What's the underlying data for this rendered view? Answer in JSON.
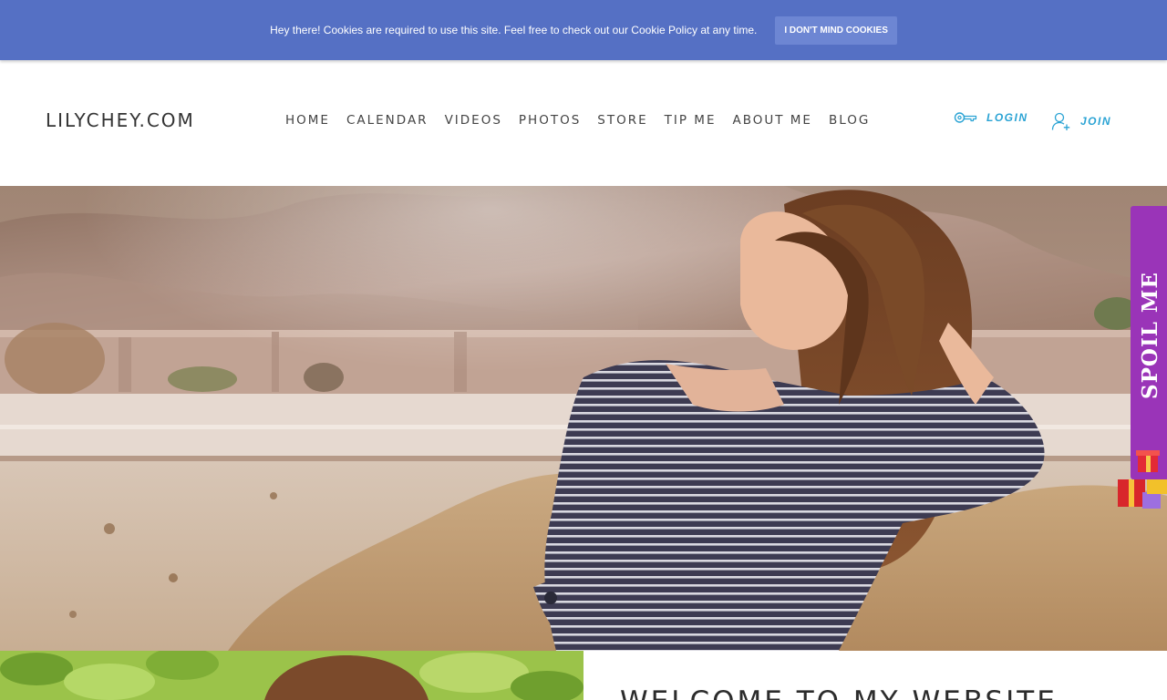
{
  "cookie_banner": {
    "message": "Hey there! Cookies are required to use this site. Feel free to check out our Cookie Policy at any time.",
    "button_label": "I DON'T MIND COOKIES"
  },
  "header": {
    "logo": "LILYCHEY.COM",
    "nav": [
      "HOME",
      "CALENDAR",
      "VIDEOS",
      "PHOTOS",
      "STORE",
      "TIP ME",
      "ABOUT ME",
      "BLOG"
    ],
    "login_label": "LOGIN",
    "join_label": "JOIN"
  },
  "spoil_tab": {
    "label": "SPOIL ME"
  },
  "welcome": {
    "heading": "WELCOME TO MY WEBSITE"
  },
  "colors": {
    "cookie_bar": "#5570c4",
    "accent_blue": "#2aa3d4",
    "spoil_purple": "#9a34b8"
  }
}
